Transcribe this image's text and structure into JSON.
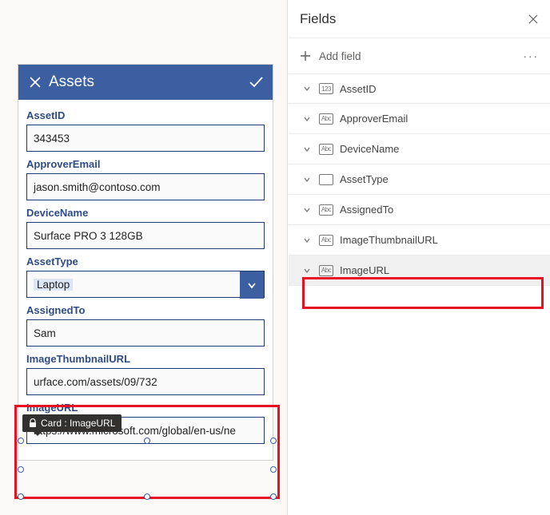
{
  "form": {
    "title": "Assets",
    "fields": [
      {
        "label": "AssetID",
        "value": "343453",
        "kind": "text"
      },
      {
        "label": "ApproverEmail",
        "value": "jason.smith@contoso.com",
        "kind": "text"
      },
      {
        "label": "DeviceName",
        "value": "Surface PRO 3 128GB",
        "kind": "text"
      },
      {
        "label": "AssetType",
        "value": "Laptop",
        "kind": "select"
      },
      {
        "label": "AssignedTo",
        "value": "Sam",
        "kind": "text"
      },
      {
        "label": "ImageThumbnailURL",
        "value": "urface.com/assets/09/732",
        "kind": "text"
      },
      {
        "label": "ImageURL",
        "value": "https://www.microsoft.com/global/en-us/ne",
        "kind": "text"
      }
    ]
  },
  "tooltip": {
    "label": "Card : ImageURL"
  },
  "panel": {
    "title": "Fields",
    "add_label": "Add field",
    "items": [
      {
        "label": "AssetID",
        "type": "num"
      },
      {
        "label": "ApproverEmail",
        "type": "abc"
      },
      {
        "label": "DeviceName",
        "type": "abc"
      },
      {
        "label": "AssetType",
        "type": "grid"
      },
      {
        "label": "AssignedTo",
        "type": "abc"
      },
      {
        "label": "ImageThumbnailURL",
        "type": "abc"
      },
      {
        "label": "ImageURL",
        "type": "abc",
        "selected": true
      }
    ]
  }
}
